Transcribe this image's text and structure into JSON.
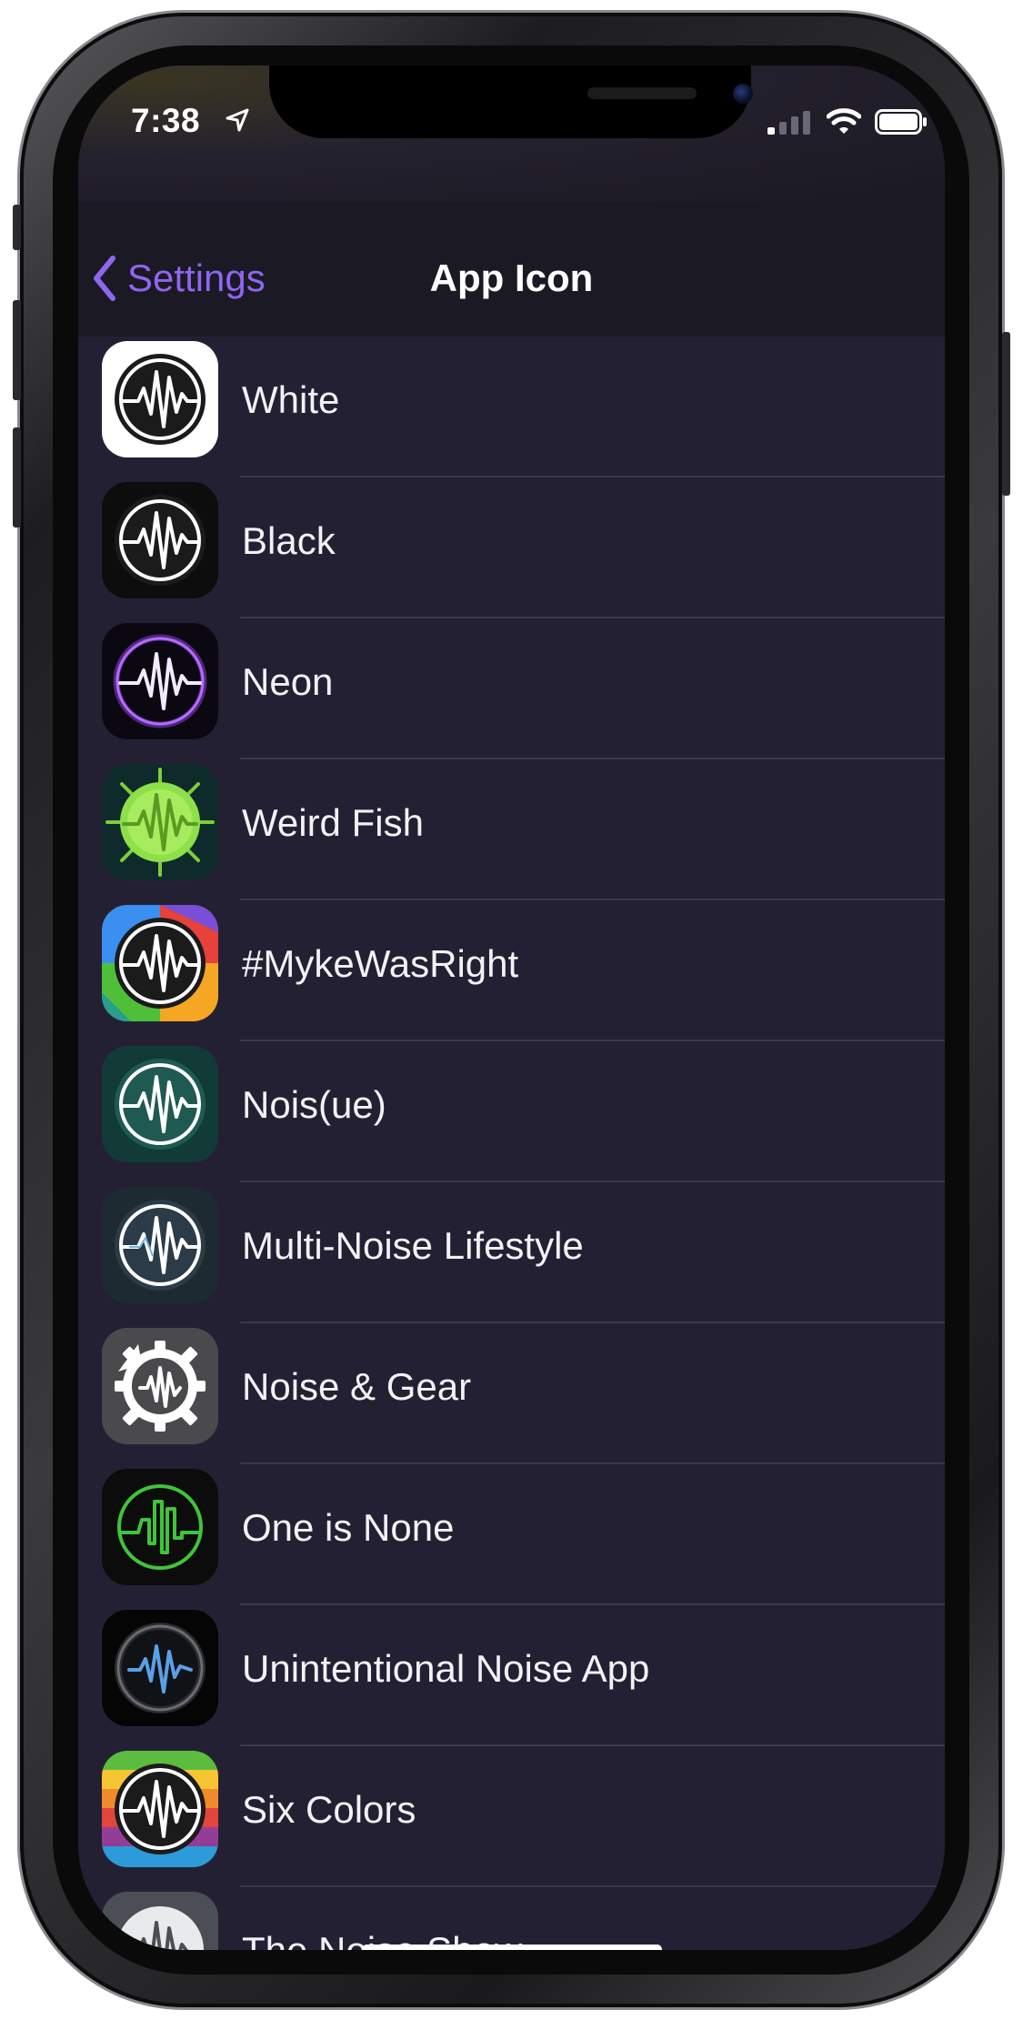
{
  "status_bar": {
    "time": "7:38"
  },
  "nav": {
    "back_label": "Settings",
    "title": "App Icon"
  },
  "icons": [
    {
      "label": "White",
      "icon": "white-icon"
    },
    {
      "label": "Black",
      "icon": "black-icon"
    },
    {
      "label": "Neon",
      "icon": "neon-icon"
    },
    {
      "label": "Weird Fish",
      "icon": "weird-fish-icon"
    },
    {
      "label": "#MykeWasRight",
      "icon": "myke-was-right-icon"
    },
    {
      "label": "Nois(ue)",
      "icon": "noisue-icon"
    },
    {
      "label": "Multi-Noise Lifestyle",
      "icon": "multi-noise-lifestyle-icon"
    },
    {
      "label": "Noise & Gear",
      "icon": "noise-gear-icon"
    },
    {
      "label": "One is None",
      "icon": "one-is-none-icon"
    },
    {
      "label": "Unintentional Noise App",
      "icon": "unintentional-noise-app-icon"
    },
    {
      "label": "Six Colors",
      "icon": "six-colors-icon"
    },
    {
      "label": "The Noise Show",
      "icon": "the-noise-show-icon"
    }
  ],
  "colors": {
    "accent": "#8f66f0",
    "background": "#242034",
    "navbar": "#1b1923",
    "separator": "#3c3849",
    "text": "#f2f2f5"
  }
}
